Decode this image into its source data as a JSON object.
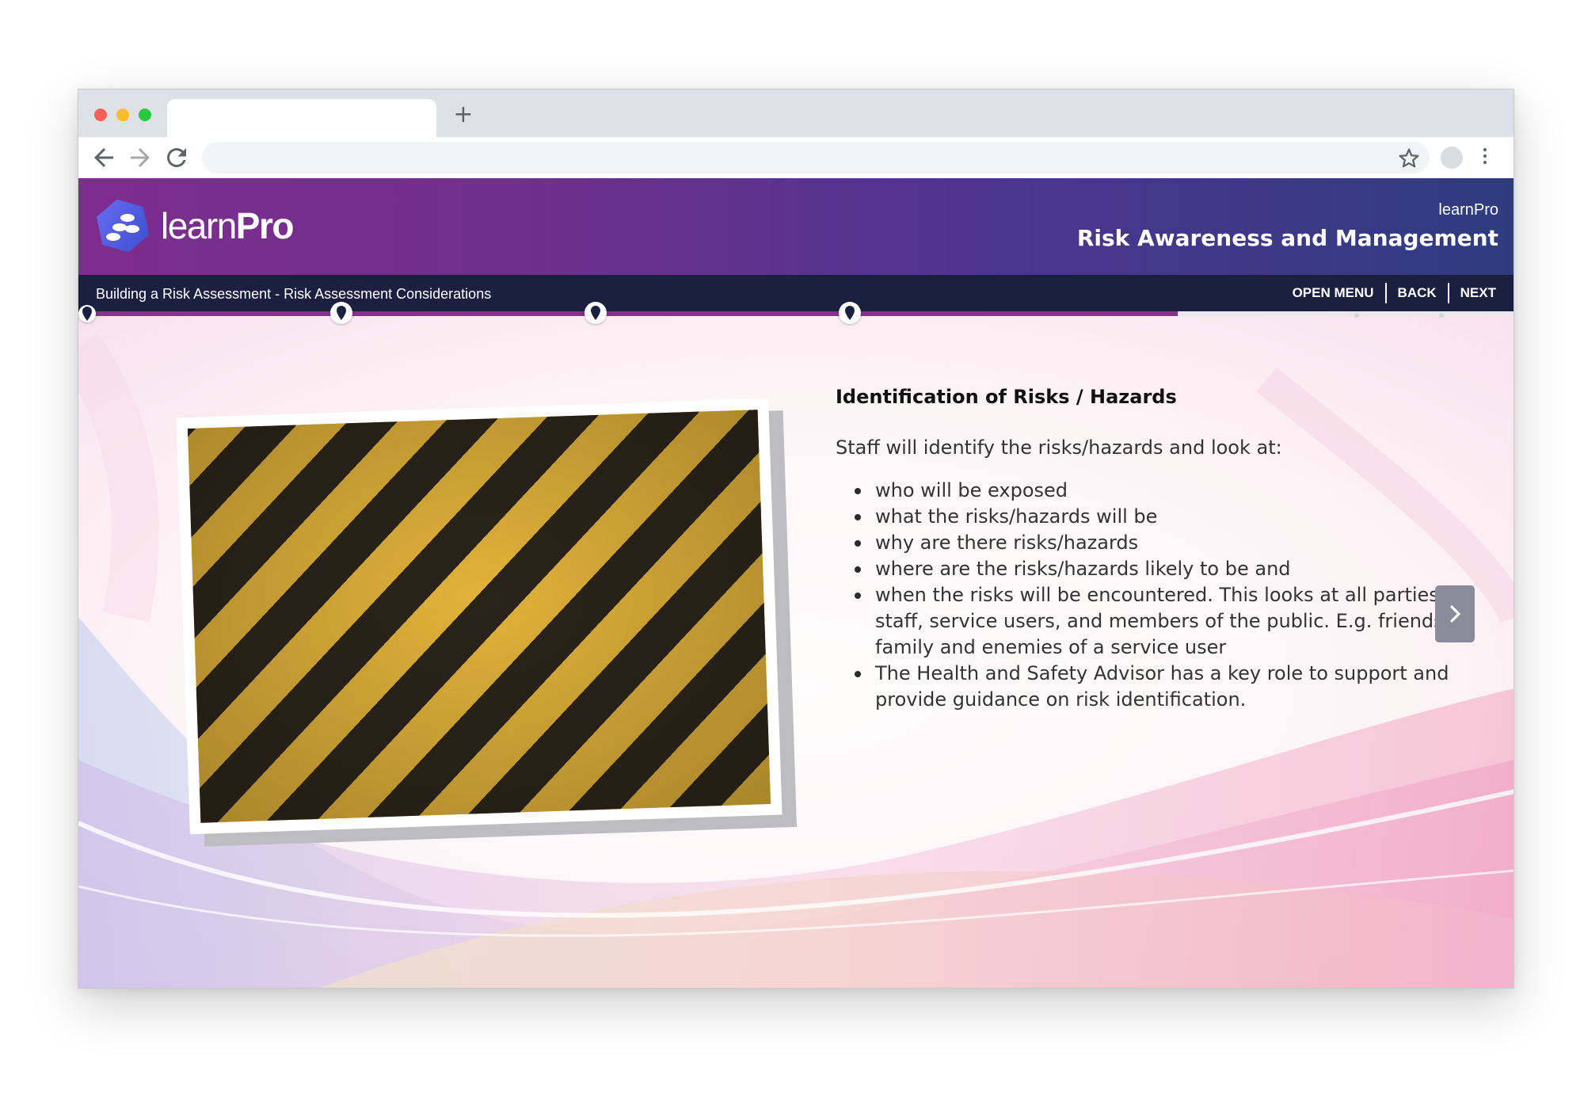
{
  "browser": {
    "new_tab_label": "+"
  },
  "header": {
    "brand_light": "learn",
    "brand_bold": "Pro",
    "organization": "learnPro",
    "course_title": "Risk Awareness and Management"
  },
  "subnav": {
    "breadcrumb": "Building a Risk Assessment - Risk Assessment Considerations",
    "open_menu": "OPEN MENU",
    "back": "BACK",
    "next": "NEXT"
  },
  "progress": {
    "fraction": 0.765,
    "markers": [
      0.006,
      0.183,
      0.36,
      0.537
    ],
    "ghost_markers": [
      0.888,
      0.947
    ]
  },
  "content": {
    "heading": "Identification of Risks / Hazards",
    "intro": "Staff will identify the risks/hazards and look at:",
    "bullets": [
      "who will be exposed",
      "what the risks/hazards will be",
      "why are there risks/hazards",
      "where are the risks/hazards likely to be and",
      "when the risks will be encountered. This looks at all parties: staff, service users, and members of the public. E.g. friends, family and enemies of a service user",
      "The Health and Safety Advisor has a key role to support and provide guidance on risk identification."
    ],
    "image_icon": "hazard-stripes-image",
    "next_arrow_icon": "chevron-right-icon"
  },
  "colors": {
    "header_start": "#7d2d8e",
    "header_end": "#2e3c7f",
    "subnav": "#1b2040",
    "progress": "#8b2f93",
    "arrow_button": "#8b8c99"
  }
}
